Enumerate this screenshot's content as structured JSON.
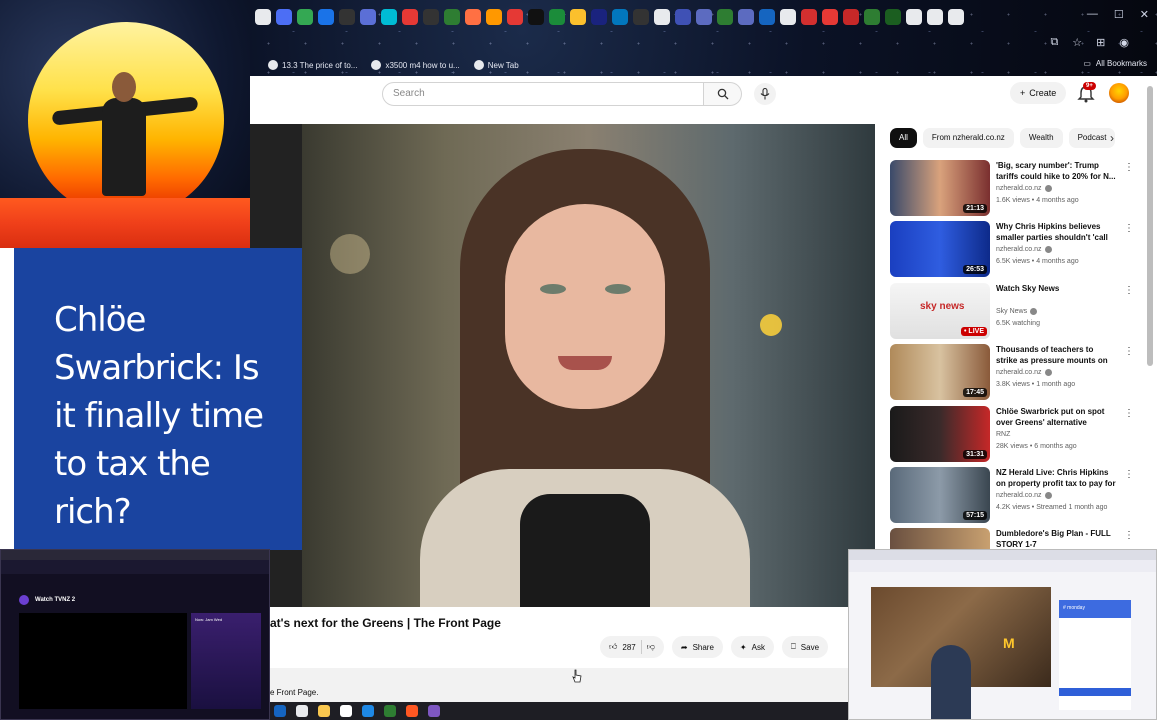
{
  "browser": {
    "tab_icons": [
      "#e8eaed",
      "#4c6ef5",
      "#34a853",
      "#1a73e8",
      "#333",
      "#5b6fd6",
      "#00bcd4",
      "#e53935",
      "#333",
      "#2e7d32",
      "#ff7043",
      "#ff9800",
      "#e53935",
      "#111",
      "#1b8c3a",
      "#fbc02d",
      "#1a237e",
      "#0277bd",
      "#333",
      "#e8eaed",
      "#3f51b5",
      "#5c6bc0",
      "#2e7d32",
      "#5c6bc0",
      "#1565c0",
      "#e8eaed",
      "#d32f2f",
      "#e53935",
      "#c62828",
      "#2e7d32",
      "#1b5e20",
      "#e8eaed",
      "#e8eaed",
      "#e8eaed"
    ],
    "bookmarks": [
      {
        "label": "13.3 The price of to..."
      },
      {
        "label": "x3500 m4 how to u..."
      },
      {
        "label": "New Tab"
      }
    ],
    "all_bookmarks": "All Bookmarks"
  },
  "youtube": {
    "search_placeholder": "Search",
    "create_label": "Create",
    "notification_count": "9+",
    "video": {
      "title": "at's next for the Greens | The Front Page",
      "likes": "287",
      "share_label": "Share",
      "ask_label": "Ask",
      "save_label": "Save",
      "description": "e Front Page."
    },
    "chips": [
      "All",
      "From nzherald.co.nz",
      "Wealth",
      "Podcast"
    ],
    "recommendations": [
      {
        "title": "'Big, scary number': Trump tariffs could hike to 20% for N...",
        "channel": "nzherald.co.nz",
        "verified": true,
        "meta": "1.6K views • 4 months ago",
        "duration": "21:13",
        "thumb": "linear-gradient(90deg,#3a4a6a 0%,#d9a27c 50%,#7a2f2f 100%)"
      },
      {
        "title": "Why Chris Hipkins believes smaller parties shouldn't 'call ...",
        "channel": "nzherald.co.nz",
        "verified": true,
        "meta": "6.5K views • 4 months ago",
        "duration": "26:53",
        "thumb": "linear-gradient(90deg,#1a3fc0 0%,#2f5de0 50%,#0d2a8a 100%)"
      },
      {
        "title": "Watch Sky News",
        "channel": "Sky News",
        "verified": true,
        "meta": "6.5K watching",
        "duration": "• LIVE",
        "live": true,
        "thumb": "linear-gradient(180deg,#f5f5f5 0%,#e0e0e0 100%)",
        "logo": "sky news"
      },
      {
        "title": "Thousands of teachers to strike as pressure mounts on public ...",
        "channel": "nzherald.co.nz",
        "verified": true,
        "meta": "3.8K views • 1 month ago",
        "duration": "17:45",
        "thumb": "linear-gradient(90deg,#b08a5a 0%,#d8c2a0 50%,#8a5a3a 100%)"
      },
      {
        "title": "Chlöe Swarbrick put on spot over Greens' alternative Budge...",
        "channel": "RNZ",
        "verified": false,
        "meta": "28K views • 6 months ago",
        "duration": "31:31",
        "thumb": "linear-gradient(90deg,#1a1a1a 0%,#3a2a2a 50%,#c62828 100%)"
      },
      {
        "title": "NZ Herald Live: Chris Hipkins on property profit tax to pay for ...",
        "channel": "nzherald.co.nz",
        "verified": true,
        "meta": "4.2K views • Streamed 1 month ago",
        "duration": "57:15",
        "thumb": "linear-gradient(90deg,#5a6a7a 0%,#8c9aa8 50%,#3a4650 100%)"
      },
      {
        "title": "Dumbledore's Big Plan - FULL STORY 1-7",
        "channel": "",
        "verified": false,
        "meta": "",
        "duration": "",
        "thumb": "linear-gradient(90deg,#6a5040 0%,#c8a070 100%)"
      }
    ]
  },
  "overlays": {
    "title_card": "Chlöe Swarbrick: Is it finally time to tax the rich?",
    "tvnz_title": "Watch TVNZ 2",
    "tvnz_info": "Now: Jam Wed",
    "mcdonalds_letter": "M",
    "promo_text": "# monday"
  },
  "colors": {
    "youtube_red": "#cc0000",
    "title_card_blue": "#1a44a0"
  }
}
